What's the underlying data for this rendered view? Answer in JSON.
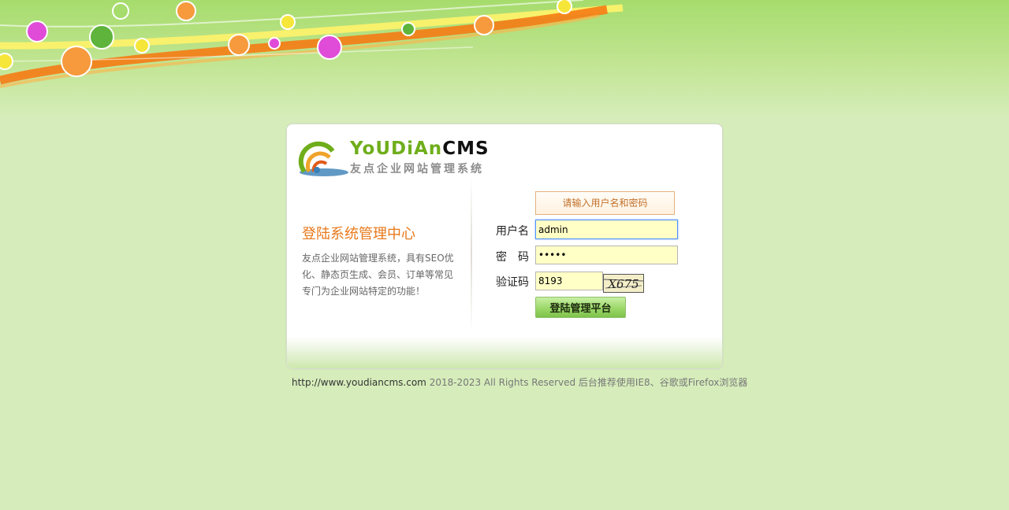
{
  "colors": {
    "page_background": "#d6edbb",
    "accent_orange": "#e8791c",
    "input_background": "#ffffc6",
    "button_green": "#9cd86a"
  },
  "logo": {
    "word_you": "YoU",
    "word_dian": "DiAn",
    "word_cms": "CMS",
    "subtitle": "友点企业网站管理系统"
  },
  "intro": {
    "title": "登陆系统管理中心",
    "description": "友点企业网站管理系统，具有SEO优化、静态页生成、会员、订单等常见专门为企业网站特定的功能！"
  },
  "form": {
    "hint": "请输入用户名和密码",
    "username_label": "用户名",
    "username_value": "admin",
    "password_label": "密　码",
    "password_value": "•••••",
    "captcha_label": "验证码",
    "captcha_value": "8193",
    "captcha_image_text": "X675",
    "submit_label": "登陆管理平台"
  },
  "footer": {
    "url": "http://www.youdiancms.com",
    "copyright": "2018-2023 All Rights Reserved 后台推荐使用IE8、谷歌或Firefox浏览器"
  }
}
